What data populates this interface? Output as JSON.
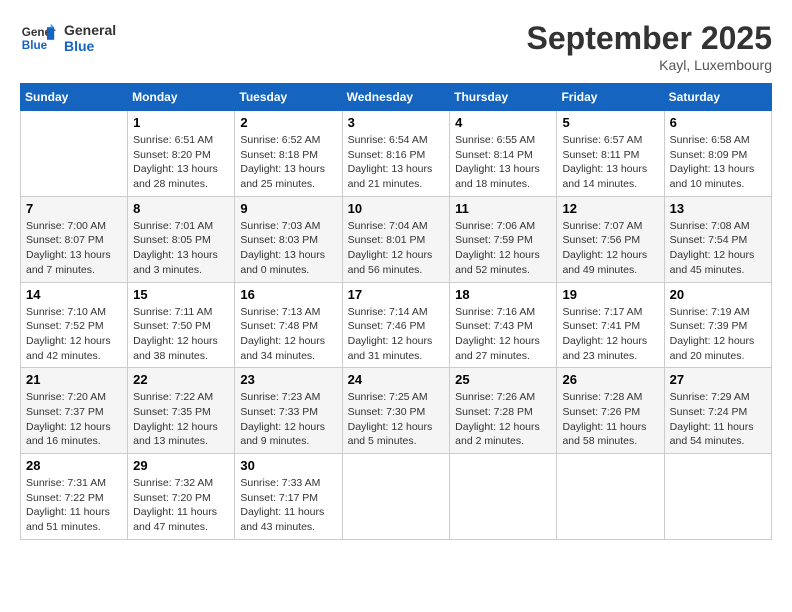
{
  "header": {
    "logo_line1": "General",
    "logo_line2": "Blue",
    "month_title": "September 2025",
    "subtitle": "Kayl, Luxembourg"
  },
  "days_of_week": [
    "Sunday",
    "Monday",
    "Tuesday",
    "Wednesday",
    "Thursday",
    "Friday",
    "Saturday"
  ],
  "weeks": [
    [
      {
        "day": "",
        "info": ""
      },
      {
        "day": "1",
        "info": "Sunrise: 6:51 AM\nSunset: 8:20 PM\nDaylight: 13 hours and 28 minutes."
      },
      {
        "day": "2",
        "info": "Sunrise: 6:52 AM\nSunset: 8:18 PM\nDaylight: 13 hours and 25 minutes."
      },
      {
        "day": "3",
        "info": "Sunrise: 6:54 AM\nSunset: 8:16 PM\nDaylight: 13 hours and 21 minutes."
      },
      {
        "day": "4",
        "info": "Sunrise: 6:55 AM\nSunset: 8:14 PM\nDaylight: 13 hours and 18 minutes."
      },
      {
        "day": "5",
        "info": "Sunrise: 6:57 AM\nSunset: 8:11 PM\nDaylight: 13 hours and 14 minutes."
      },
      {
        "day": "6",
        "info": "Sunrise: 6:58 AM\nSunset: 8:09 PM\nDaylight: 13 hours and 10 minutes."
      }
    ],
    [
      {
        "day": "7",
        "info": "Sunrise: 7:00 AM\nSunset: 8:07 PM\nDaylight: 13 hours and 7 minutes."
      },
      {
        "day": "8",
        "info": "Sunrise: 7:01 AM\nSunset: 8:05 PM\nDaylight: 13 hours and 3 minutes."
      },
      {
        "day": "9",
        "info": "Sunrise: 7:03 AM\nSunset: 8:03 PM\nDaylight: 13 hours and 0 minutes."
      },
      {
        "day": "10",
        "info": "Sunrise: 7:04 AM\nSunset: 8:01 PM\nDaylight: 12 hours and 56 minutes."
      },
      {
        "day": "11",
        "info": "Sunrise: 7:06 AM\nSunset: 7:59 PM\nDaylight: 12 hours and 52 minutes."
      },
      {
        "day": "12",
        "info": "Sunrise: 7:07 AM\nSunset: 7:56 PM\nDaylight: 12 hours and 49 minutes."
      },
      {
        "day": "13",
        "info": "Sunrise: 7:08 AM\nSunset: 7:54 PM\nDaylight: 12 hours and 45 minutes."
      }
    ],
    [
      {
        "day": "14",
        "info": "Sunrise: 7:10 AM\nSunset: 7:52 PM\nDaylight: 12 hours and 42 minutes."
      },
      {
        "day": "15",
        "info": "Sunrise: 7:11 AM\nSunset: 7:50 PM\nDaylight: 12 hours and 38 minutes."
      },
      {
        "day": "16",
        "info": "Sunrise: 7:13 AM\nSunset: 7:48 PM\nDaylight: 12 hours and 34 minutes."
      },
      {
        "day": "17",
        "info": "Sunrise: 7:14 AM\nSunset: 7:46 PM\nDaylight: 12 hours and 31 minutes."
      },
      {
        "day": "18",
        "info": "Sunrise: 7:16 AM\nSunset: 7:43 PM\nDaylight: 12 hours and 27 minutes."
      },
      {
        "day": "19",
        "info": "Sunrise: 7:17 AM\nSunset: 7:41 PM\nDaylight: 12 hours and 23 minutes."
      },
      {
        "day": "20",
        "info": "Sunrise: 7:19 AM\nSunset: 7:39 PM\nDaylight: 12 hours and 20 minutes."
      }
    ],
    [
      {
        "day": "21",
        "info": "Sunrise: 7:20 AM\nSunset: 7:37 PM\nDaylight: 12 hours and 16 minutes."
      },
      {
        "day": "22",
        "info": "Sunrise: 7:22 AM\nSunset: 7:35 PM\nDaylight: 12 hours and 13 minutes."
      },
      {
        "day": "23",
        "info": "Sunrise: 7:23 AM\nSunset: 7:33 PM\nDaylight: 12 hours and 9 minutes."
      },
      {
        "day": "24",
        "info": "Sunrise: 7:25 AM\nSunset: 7:30 PM\nDaylight: 12 hours and 5 minutes."
      },
      {
        "day": "25",
        "info": "Sunrise: 7:26 AM\nSunset: 7:28 PM\nDaylight: 12 hours and 2 minutes."
      },
      {
        "day": "26",
        "info": "Sunrise: 7:28 AM\nSunset: 7:26 PM\nDaylight: 11 hours and 58 minutes."
      },
      {
        "day": "27",
        "info": "Sunrise: 7:29 AM\nSunset: 7:24 PM\nDaylight: 11 hours and 54 minutes."
      }
    ],
    [
      {
        "day": "28",
        "info": "Sunrise: 7:31 AM\nSunset: 7:22 PM\nDaylight: 11 hours and 51 minutes."
      },
      {
        "day": "29",
        "info": "Sunrise: 7:32 AM\nSunset: 7:20 PM\nDaylight: 11 hours and 47 minutes."
      },
      {
        "day": "30",
        "info": "Sunrise: 7:33 AM\nSunset: 7:17 PM\nDaylight: 11 hours and 43 minutes."
      },
      {
        "day": "",
        "info": ""
      },
      {
        "day": "",
        "info": ""
      },
      {
        "day": "",
        "info": ""
      },
      {
        "day": "",
        "info": ""
      }
    ]
  ]
}
